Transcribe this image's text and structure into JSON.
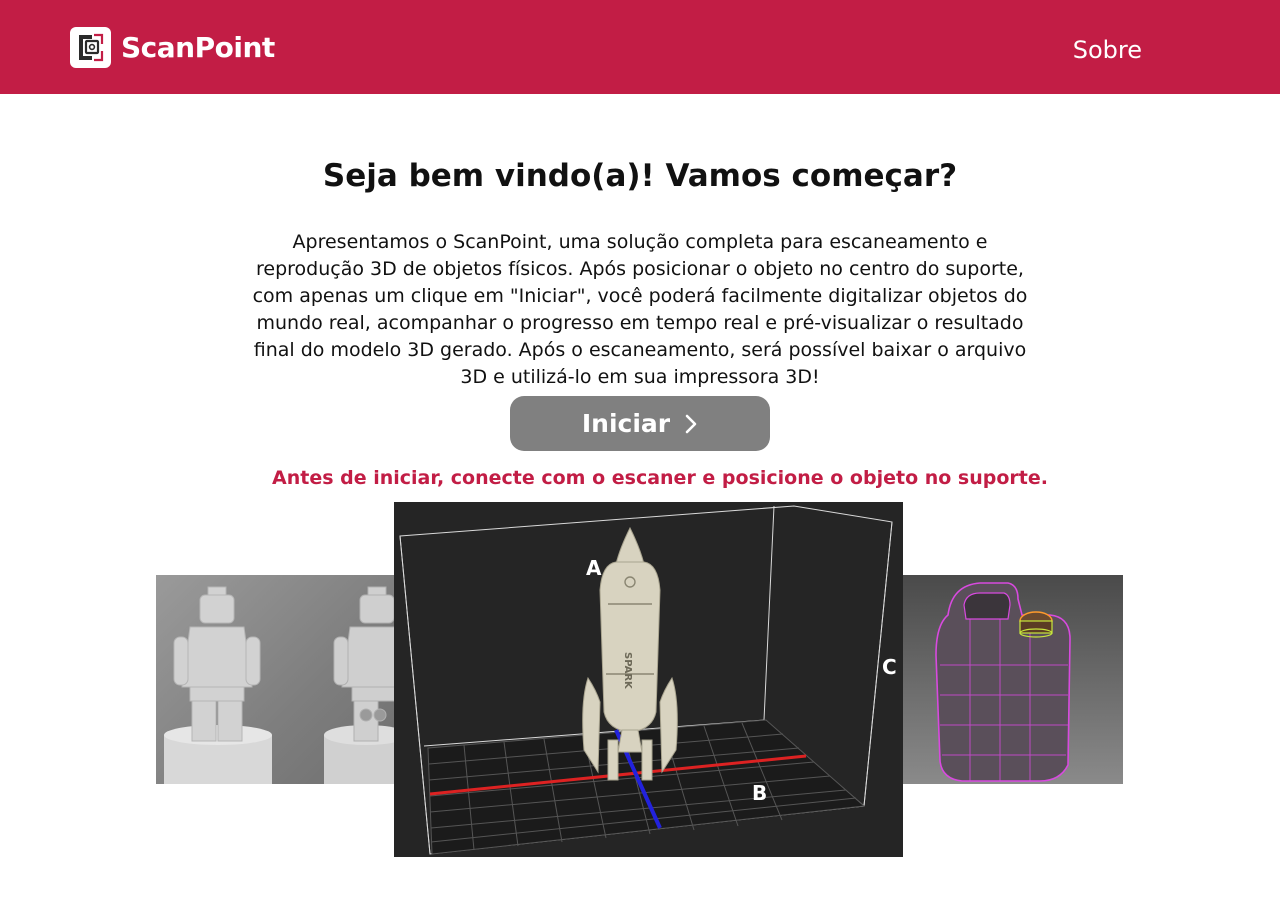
{
  "header": {
    "brand": "ScanPoint",
    "nav_about": "Sobre",
    "brand_color": "#c21d45"
  },
  "main": {
    "title": "Seja bem vindo(a)! Vamos começar?",
    "intro": "Apresentamos o ScanPoint, uma solução completa para escaneamento e reprodução 3D de objetos físicos. Após posicionar o objeto no centro do suporte, com apenas um clique em \"Iniciar\", você poderá facilmente digitalizar objetos do mundo real, acompanhar o progresso em tempo real e pré-visualizar o resultado final do modelo 3D gerado. Após o escaneamento, será possível baixar o arquivo 3D e utilizá-lo em sua impressora 3D!",
    "start_label": "Iniciar",
    "start_icon": "chevron-right-icon",
    "warning": "Antes de iniciar, conecte com o escaner e posicione o objeto no suporte."
  },
  "carousel": {
    "axis_labels": [
      "A",
      "B",
      "C"
    ],
    "rocket_text": "SPARK"
  }
}
